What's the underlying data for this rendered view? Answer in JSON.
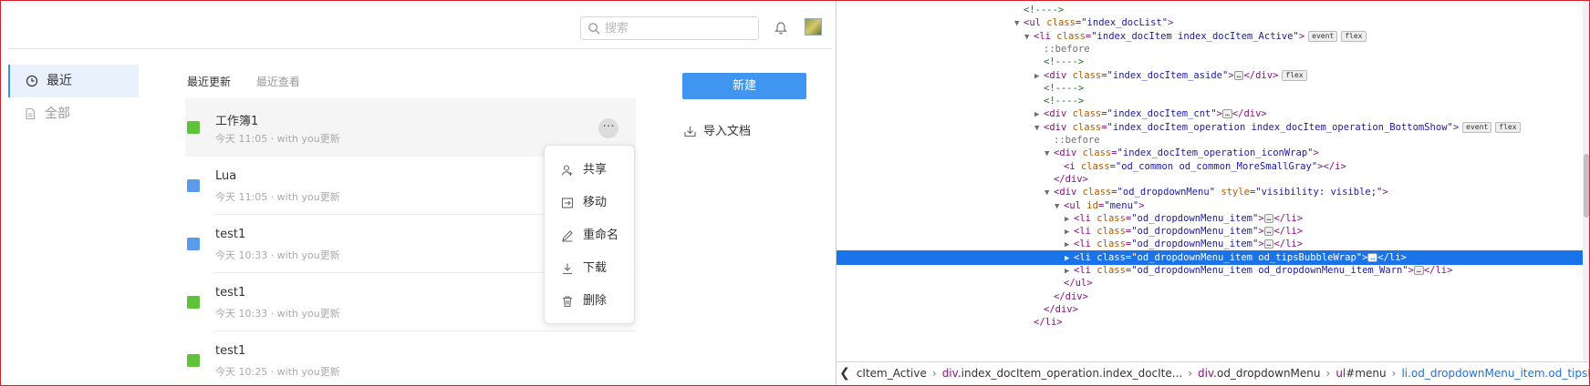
{
  "app": {
    "search_placeholder": "搜索",
    "sidebar": [
      {
        "label": "最近",
        "icon": "clock-icon",
        "active": true
      },
      {
        "label": "全部",
        "icon": "document-icon",
        "active": false
      }
    ],
    "tabs": [
      {
        "label": "最近更新",
        "active": true
      },
      {
        "label": "最近查看",
        "active": false
      }
    ],
    "documents": [
      {
        "name": "工作簿1",
        "meta": "今天 11:05  ·  with you更新",
        "type": "sheet",
        "icon": "spreadsheet-icon"
      },
      {
        "name": "Lua",
        "meta": "今天 11:05  ·  with you更新",
        "type": "doc",
        "icon": "document-icon"
      },
      {
        "name": "test1",
        "meta": "今天 10:33  ·  with you更新",
        "type": "doc",
        "icon": "document-icon"
      },
      {
        "name": "test1",
        "meta": "今天 10:33  ·  with you更新",
        "type": "sheet",
        "icon": "spreadsheet-icon"
      },
      {
        "name": "test1",
        "meta": "今天 10:25  ·  with you更新",
        "type": "sheet",
        "icon": "spreadsheet-icon"
      }
    ],
    "more_label": "···",
    "new_button": "新建",
    "import_label": "导入文档",
    "menu": [
      {
        "label": "共享",
        "icon": "share-user-icon"
      },
      {
        "label": "移动",
        "icon": "move-icon"
      },
      {
        "label": "重命名",
        "icon": "pencil-icon"
      },
      {
        "label": "下载",
        "icon": "download-icon"
      },
      {
        "label": "删除",
        "icon": "trash-icon"
      }
    ]
  },
  "devtools": {
    "lines": [
      {
        "indent": 0,
        "twisty": "",
        "parts": [
          [
            "cmt",
            "<!---->"
          ]
        ]
      },
      {
        "indent": 0,
        "twisty": "▼",
        "parts": [
          [
            "tag",
            "<ul "
          ],
          [
            "attr",
            "class"
          ],
          [
            "tag",
            "="
          ],
          [
            "val",
            "\"index_docList\""
          ],
          [
            "tag",
            ">"
          ]
        ]
      },
      {
        "indent": 1,
        "twisty": "▼",
        "parts": [
          [
            "tag",
            "<li "
          ],
          [
            "attr",
            "class"
          ],
          [
            "tag",
            "="
          ],
          [
            "val",
            "\"index_docItem index_docItem_Active\""
          ],
          [
            "tag",
            ">"
          ]
        ],
        "badges": [
          "event",
          "flex"
        ]
      },
      {
        "indent": 2,
        "twisty": "",
        "parts": [
          [
            "pse",
            "::before"
          ]
        ]
      },
      {
        "indent": 2,
        "twisty": "",
        "parts": [
          [
            "cmt",
            "<!---->"
          ]
        ]
      },
      {
        "indent": 2,
        "twisty": "▶",
        "parts": [
          [
            "tag",
            "<div "
          ],
          [
            "attr",
            "class"
          ],
          [
            "tag",
            "="
          ],
          [
            "val",
            "\"index_docItem_aside\""
          ],
          [
            "tag",
            ">"
          ],
          [
            "ell",
            "…"
          ],
          [
            "tag",
            "</div>"
          ]
        ],
        "badges": [
          "flex"
        ]
      },
      {
        "indent": 2,
        "twisty": "",
        "parts": [
          [
            "cmt",
            "<!---->"
          ]
        ]
      },
      {
        "indent": 2,
        "twisty": "",
        "parts": [
          [
            "cmt",
            "<!---->"
          ]
        ]
      },
      {
        "indent": 2,
        "twisty": "▶",
        "parts": [
          [
            "tag",
            "<div "
          ],
          [
            "attr",
            "class"
          ],
          [
            "tag",
            "="
          ],
          [
            "val",
            "\"index_docItem_cnt\""
          ],
          [
            "tag",
            ">"
          ],
          [
            "ell",
            "…"
          ],
          [
            "tag",
            "</div>"
          ]
        ]
      },
      {
        "indent": 2,
        "twisty": "▼",
        "parts": [
          [
            "tag",
            "<div "
          ],
          [
            "attr",
            "class"
          ],
          [
            "tag",
            "="
          ],
          [
            "val",
            "\"index_docItem_operation index_docItem_operation_BottomShow\""
          ],
          [
            "tag",
            ">"
          ]
        ],
        "badges": [
          "event",
          "flex"
        ]
      },
      {
        "indent": 3,
        "twisty": "",
        "parts": [
          [
            "pse",
            "::before"
          ]
        ]
      },
      {
        "indent": 3,
        "twisty": "▼",
        "parts": [
          [
            "tag",
            "<div "
          ],
          [
            "attr",
            "class"
          ],
          [
            "tag",
            "="
          ],
          [
            "val",
            "\"index_docItem_operation_iconWrap\""
          ],
          [
            "tag",
            ">"
          ]
        ]
      },
      {
        "indent": 4,
        "twisty": "",
        "parts": [
          [
            "tag",
            "<i "
          ],
          [
            "attr",
            "class"
          ],
          [
            "tag",
            "="
          ],
          [
            "val",
            "\"od_common od_common_MoreSmallGray\""
          ],
          [
            "tag",
            "></i>"
          ]
        ]
      },
      {
        "indent": 3,
        "twisty": "",
        "parts": [
          [
            "tag",
            "</div>"
          ]
        ]
      },
      {
        "indent": 3,
        "twisty": "▼",
        "parts": [
          [
            "tag",
            "<div "
          ],
          [
            "attr",
            "class"
          ],
          [
            "tag",
            "="
          ],
          [
            "val",
            "\"od_dropdownMenu\""
          ],
          [
            "tag",
            " "
          ],
          [
            "attr",
            "style"
          ],
          [
            "tag",
            "="
          ],
          [
            "val",
            "\"visibility: visible;\""
          ],
          [
            "tag",
            ">"
          ]
        ]
      },
      {
        "indent": 4,
        "twisty": "▼",
        "parts": [
          [
            "tag",
            "<ul "
          ],
          [
            "attr",
            "id"
          ],
          [
            "tag",
            "="
          ],
          [
            "val",
            "\"menu\""
          ],
          [
            "tag",
            ">"
          ]
        ]
      },
      {
        "indent": 5,
        "twisty": "▶",
        "parts": [
          [
            "tag",
            "<li "
          ],
          [
            "attr",
            "class"
          ],
          [
            "tag",
            "="
          ],
          [
            "val",
            "\"od_dropdownMenu_item\""
          ],
          [
            "tag",
            ">"
          ],
          [
            "ell",
            "…"
          ],
          [
            "tag",
            "</li>"
          ]
        ]
      },
      {
        "indent": 5,
        "twisty": "▶",
        "parts": [
          [
            "tag",
            "<li "
          ],
          [
            "attr",
            "class"
          ],
          [
            "tag",
            "="
          ],
          [
            "val",
            "\"od_dropdownMenu_item\""
          ],
          [
            "tag",
            ">"
          ],
          [
            "ell",
            "…"
          ],
          [
            "tag",
            "</li>"
          ]
        ]
      },
      {
        "indent": 5,
        "twisty": "▶",
        "parts": [
          [
            "tag",
            "<li "
          ],
          [
            "attr",
            "class"
          ],
          [
            "tag",
            "="
          ],
          [
            "val",
            "\"od_dropdownMenu_item\""
          ],
          [
            "tag",
            ">"
          ],
          [
            "ell",
            "…"
          ],
          [
            "tag",
            "</li>"
          ]
        ]
      },
      {
        "indent": 5,
        "twisty": "▶",
        "selected": true,
        "parts": [
          [
            "tag",
            "<li "
          ],
          [
            "attr",
            "class"
          ],
          [
            "tag",
            "="
          ],
          [
            "val",
            "\"od_dropdownMenu_item od_tipsBubbleWrap\""
          ],
          [
            "tag",
            ">"
          ],
          [
            "ell",
            "…"
          ],
          [
            "tag",
            "</li>"
          ]
        ]
      },
      {
        "indent": 5,
        "twisty": "▶",
        "parts": [
          [
            "tag",
            "<li "
          ],
          [
            "attr",
            "class"
          ],
          [
            "tag",
            "="
          ],
          [
            "val",
            "\"od_dropdownMenu_item od_dropdownMenu_item_Warn\""
          ],
          [
            "tag",
            ">"
          ],
          [
            "ell",
            "…"
          ],
          [
            "tag",
            "</li>"
          ]
        ]
      },
      {
        "indent": 4,
        "twisty": "",
        "parts": [
          [
            "tag",
            "</ul>"
          ]
        ]
      },
      {
        "indent": 3,
        "twisty": "",
        "parts": [
          [
            "tag",
            "</div>"
          ]
        ]
      },
      {
        "indent": 2,
        "twisty": "",
        "parts": [
          [
            "tag",
            "</div>"
          ]
        ]
      },
      {
        "indent": 1,
        "twisty": "",
        "parts": [
          [
            "tag",
            "</li>"
          ]
        ]
      }
    ],
    "breadcrumbs": [
      {
        "tag": "",
        "rest": "cItem_Active"
      },
      {
        "tag": "div",
        "rest": ".index_docItem_operation.index_docIte..."
      },
      {
        "tag": "div",
        "rest": ".od_dropdownMenu"
      },
      {
        "tag": "ul",
        "rest": "#menu"
      },
      {
        "tag": "li",
        "rest": ".od_dropdownMenu_item.od_tipsBubbleWra..."
      }
    ],
    "back_label": "❮"
  }
}
